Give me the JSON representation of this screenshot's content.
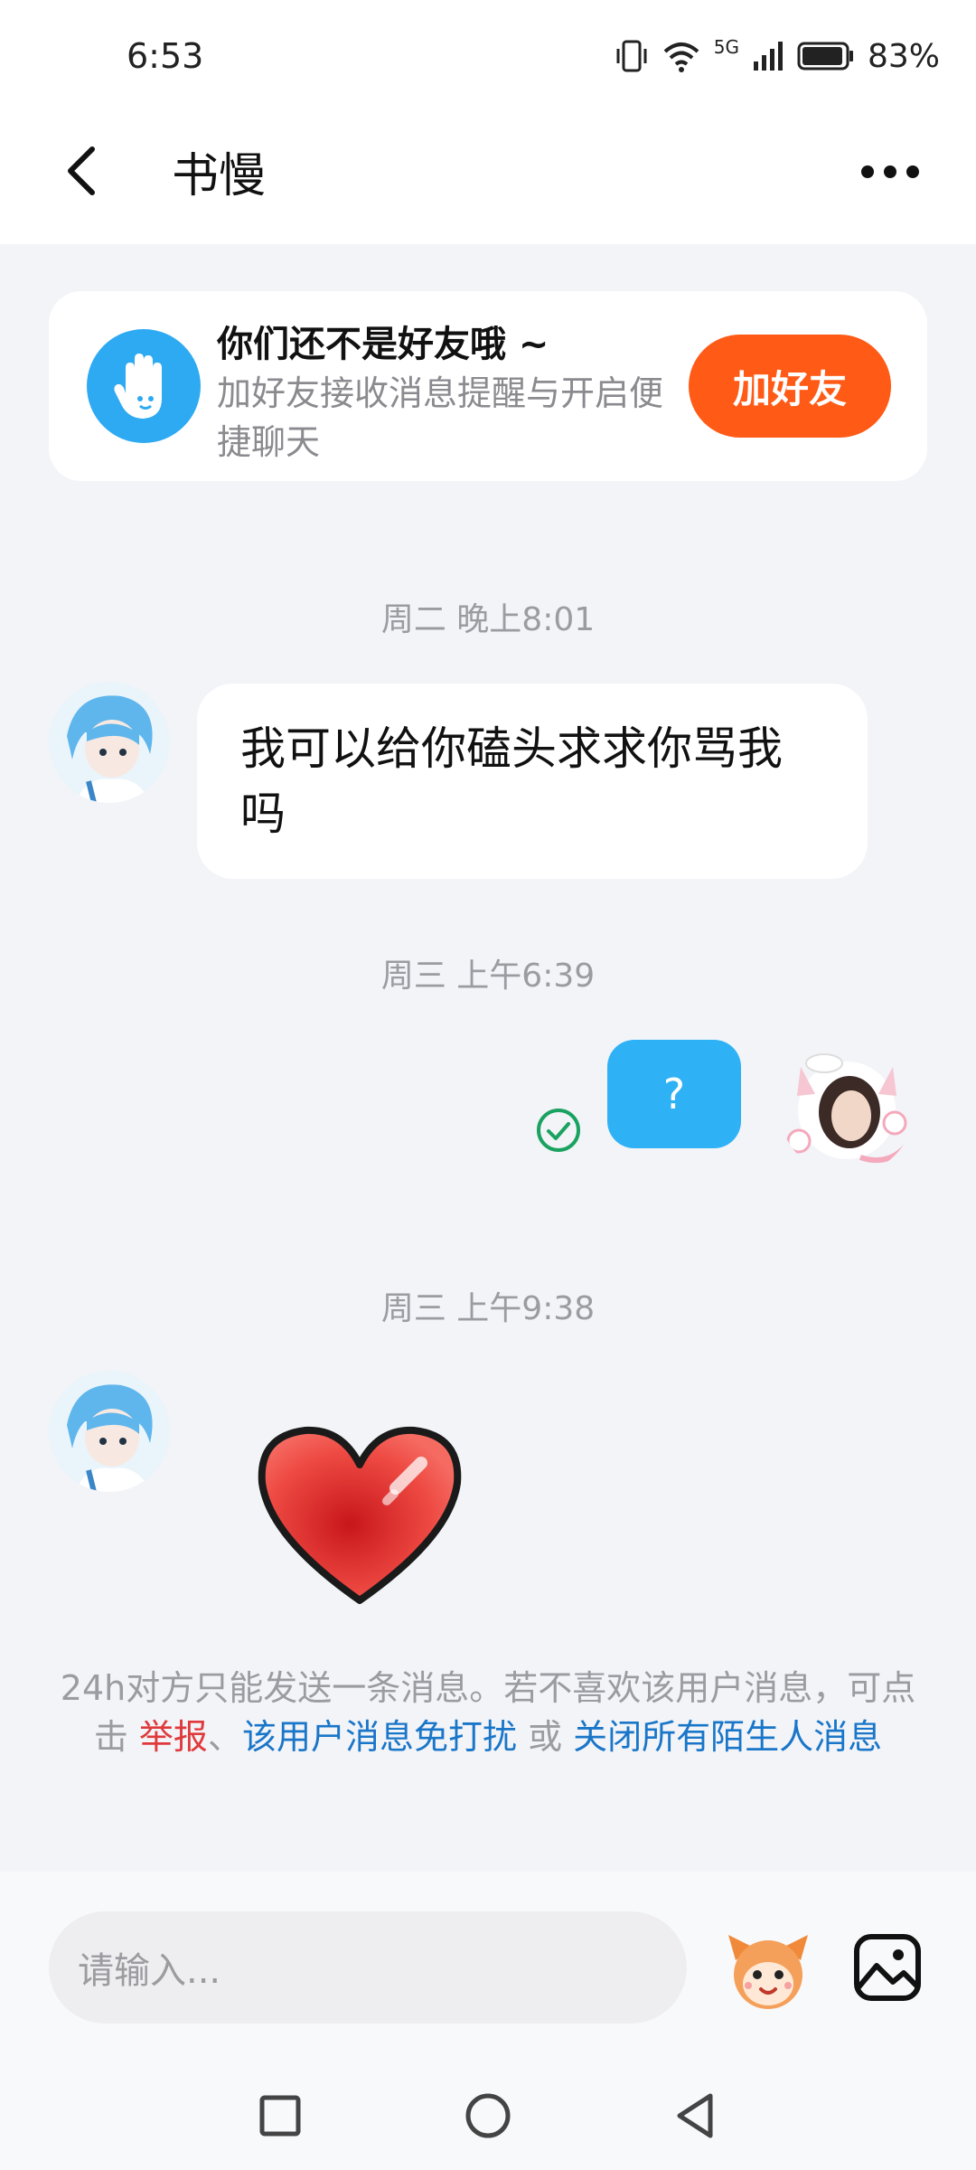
{
  "status_bar": {
    "time": "6:53",
    "battery": "83%",
    "network": "5G"
  },
  "header": {
    "title": "书慢",
    "back_icon": "chevron-left-icon",
    "more_icon": "more-dots-icon"
  },
  "friend_card": {
    "title": "你们还不是好友哦 ~",
    "description": "加好友接收消息提醒与开启便捷聊天",
    "button_label": "加好友",
    "button_color": "#ff5a16"
  },
  "messages": [
    {
      "timestamp": "周二 晚上8:01",
      "direction": "incoming",
      "type": "text",
      "text": "我可以给你磕头求求你骂我吗"
    },
    {
      "timestamp": "周三 上午6:39",
      "direction": "outgoing",
      "type": "text",
      "text": "?"
    },
    {
      "timestamp": "周三 上午9:38",
      "direction": "incoming",
      "type": "sticker",
      "sticker": "red-heart"
    }
  ],
  "notice": {
    "line1": "24h对方只能发送一条消息。若不喜欢该用户消息，可点击",
    "report": "举报",
    "separator": "、",
    "mute": "该用户消息免打扰",
    "or": "或",
    "close_all": "关闭所有陌生人消息"
  },
  "input": {
    "placeholder": "请输入..."
  },
  "colors": {
    "accent_blue": "#2eb2f5",
    "link_blue": "#1a76c8",
    "report_red": "#e0393b",
    "read_check_green": "#1aa260"
  }
}
